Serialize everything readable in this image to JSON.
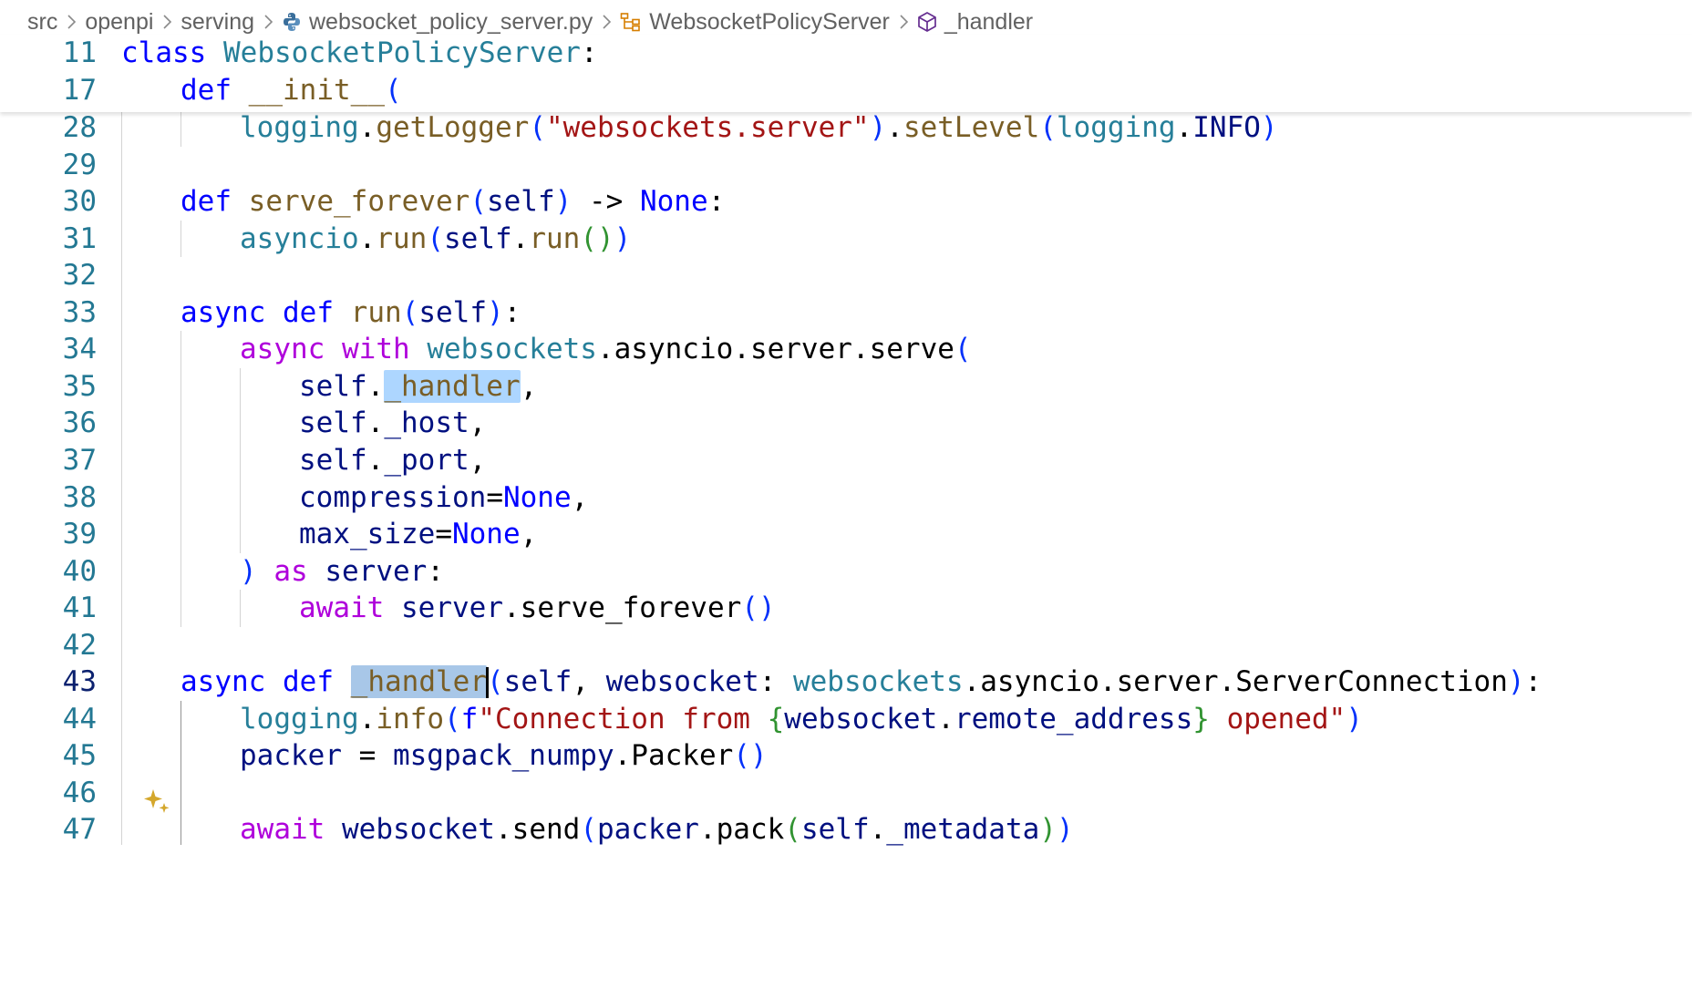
{
  "breadcrumb": {
    "items": [
      {
        "label": "src",
        "icon": ""
      },
      {
        "label": "openpi",
        "icon": ""
      },
      {
        "label": "serving",
        "icon": ""
      },
      {
        "label": "websocket_policy_server.py",
        "icon": "python-file-icon"
      },
      {
        "label": "WebsocketPolicyServer",
        "icon": "class-symbol-icon"
      },
      {
        "label": "_handler",
        "icon": "method-symbol-icon"
      }
    ]
  },
  "colors": {
    "keyword": "#0000ff",
    "control": "#af00db",
    "class": "#267f99",
    "function": "#795e26",
    "variable": "#001080",
    "string": "#a31515",
    "line_number": "#237893",
    "line_number_active": "#0b216f",
    "selection_highlight": "#add6ff",
    "sparkle": "#d4a72c"
  },
  "editor": {
    "active_line": "43",
    "sticky": [
      {
        "num": "11",
        "indent": 0,
        "tokens": [
          [
            "kw",
            "class"
          ],
          [
            "txt",
            " "
          ],
          [
            "cls",
            "WebsocketPolicyServer"
          ],
          [
            "txt",
            ":"
          ]
        ]
      },
      {
        "num": "17",
        "indent": 1,
        "tokens": [
          [
            "kw",
            "def"
          ],
          [
            "txt",
            " "
          ],
          [
            "fn",
            "__init__"
          ],
          [
            "p1",
            "("
          ]
        ]
      }
    ],
    "lines": [
      {
        "num": "28",
        "indent": 2,
        "tokens": [
          [
            "cls",
            "logging"
          ],
          [
            "txt",
            "."
          ],
          [
            "fn",
            "getLogger"
          ],
          [
            "p1",
            "("
          ],
          [
            "str",
            "\"websockets.server\""
          ],
          [
            "p1",
            ")"
          ],
          [
            "txt",
            "."
          ],
          [
            "fn",
            "setLevel"
          ],
          [
            "p1",
            "("
          ],
          [
            "cls",
            "logging"
          ],
          [
            "txt",
            "."
          ],
          [
            "var",
            "INFO"
          ],
          [
            "p1",
            ")"
          ]
        ]
      },
      {
        "num": "29",
        "indent": 0,
        "tokens": []
      },
      {
        "num": "30",
        "indent": 1,
        "tokens": [
          [
            "kw",
            "def"
          ],
          [
            "txt",
            " "
          ],
          [
            "fn",
            "serve_forever"
          ],
          [
            "p1",
            "("
          ],
          [
            "var",
            "self"
          ],
          [
            "p1",
            ")"
          ],
          [
            "txt",
            " -> "
          ],
          [
            "kw",
            "None"
          ],
          [
            "txt",
            ":"
          ]
        ]
      },
      {
        "num": "31",
        "indent": 2,
        "tokens": [
          [
            "cls",
            "asyncio"
          ],
          [
            "txt",
            "."
          ],
          [
            "fn",
            "run"
          ],
          [
            "p1",
            "("
          ],
          [
            "var",
            "self"
          ],
          [
            "txt",
            "."
          ],
          [
            "fn",
            "run"
          ],
          [
            "p2",
            "()"
          ],
          [
            "p1",
            ")"
          ]
        ]
      },
      {
        "num": "32",
        "indent": 0,
        "tokens": []
      },
      {
        "num": "33",
        "indent": 1,
        "tokens": [
          [
            "kw",
            "async"
          ],
          [
            "txt",
            " "
          ],
          [
            "kw",
            "def"
          ],
          [
            "txt",
            " "
          ],
          [
            "fn",
            "run"
          ],
          [
            "p1",
            "("
          ],
          [
            "var",
            "self"
          ],
          [
            "p1",
            ")"
          ],
          [
            "txt",
            ":"
          ]
        ]
      },
      {
        "num": "34",
        "indent": 2,
        "tokens": [
          [
            "ctl",
            "async"
          ],
          [
            "txt",
            " "
          ],
          [
            "ctl",
            "with"
          ],
          [
            "txt",
            " "
          ],
          [
            "cls",
            "websockets"
          ],
          [
            "txt",
            ".asyncio.server.serve"
          ],
          [
            "p1",
            "("
          ]
        ]
      },
      {
        "num": "35",
        "indent": 3,
        "tokens": [
          [
            "var",
            "self"
          ],
          [
            "txt",
            "."
          ],
          [
            "fnhl",
            "_handler"
          ],
          [
            "txt",
            ","
          ]
        ]
      },
      {
        "num": "36",
        "indent": 3,
        "tokens": [
          [
            "var",
            "self"
          ],
          [
            "txt",
            "."
          ],
          [
            "var",
            "_host"
          ],
          [
            "txt",
            ","
          ]
        ]
      },
      {
        "num": "37",
        "indent": 3,
        "tokens": [
          [
            "var",
            "self"
          ],
          [
            "txt",
            "."
          ],
          [
            "var",
            "_port"
          ],
          [
            "txt",
            ","
          ]
        ]
      },
      {
        "num": "38",
        "indent": 3,
        "tokens": [
          [
            "var",
            "compression"
          ],
          [
            "txt",
            "="
          ],
          [
            "kw",
            "None"
          ],
          [
            "txt",
            ","
          ]
        ]
      },
      {
        "num": "39",
        "indent": 3,
        "tokens": [
          [
            "var",
            "max_size"
          ],
          [
            "txt",
            "="
          ],
          [
            "kw",
            "None"
          ],
          [
            "txt",
            ","
          ]
        ]
      },
      {
        "num": "40",
        "indent": 2,
        "tokens": [
          [
            "p1",
            ")"
          ],
          [
            "txt",
            " "
          ],
          [
            "ctl",
            "as"
          ],
          [
            "txt",
            " "
          ],
          [
            "var",
            "server"
          ],
          [
            "txt",
            ":"
          ]
        ]
      },
      {
        "num": "41",
        "indent": 3,
        "tokens": [
          [
            "ctl",
            "await"
          ],
          [
            "txt",
            " "
          ],
          [
            "var",
            "server"
          ],
          [
            "txt",
            "."
          ],
          [
            "txt",
            "serve_forever"
          ],
          [
            "p1",
            "()"
          ]
        ]
      },
      {
        "num": "42",
        "indent": 0,
        "tokens": []
      },
      {
        "num": "43",
        "indent": 1,
        "tokens": [
          [
            "kw",
            "async"
          ],
          [
            "txt",
            " "
          ],
          [
            "kw",
            "def"
          ],
          [
            "txt",
            " "
          ],
          [
            "fnhl2",
            "_handler"
          ],
          [
            "p1",
            "("
          ],
          [
            "var",
            "self"
          ],
          [
            "txt",
            ", "
          ],
          [
            "var",
            "websocket"
          ],
          [
            "txt",
            ": "
          ],
          [
            "cls",
            "websockets"
          ],
          [
            "txt",
            "."
          ],
          [
            "txt",
            "asyncio"
          ],
          [
            "txt",
            "."
          ],
          [
            "txt",
            "server"
          ],
          [
            "txt",
            "."
          ],
          [
            "txt",
            "ServerConnection"
          ],
          [
            "p1",
            ")"
          ],
          [
            "txt",
            ":"
          ]
        ]
      },
      {
        "num": "44",
        "indent": 2,
        "tokens": [
          [
            "cls",
            "logging"
          ],
          [
            "txt",
            "."
          ],
          [
            "fn",
            "info"
          ],
          [
            "p1",
            "("
          ],
          [
            "kw",
            "f"
          ],
          [
            "str",
            "\"Connection from "
          ],
          [
            "p2",
            "{"
          ],
          [
            "var",
            "websocket"
          ],
          [
            "txt",
            "."
          ],
          [
            "var",
            "remote_address"
          ],
          [
            "p2",
            "}"
          ],
          [
            "str",
            " opened\""
          ],
          [
            "p1",
            ")"
          ]
        ]
      },
      {
        "num": "45",
        "indent": 2,
        "tokens": [
          [
            "var",
            "packer"
          ],
          [
            "txt",
            " = "
          ],
          [
            "var",
            "msgpack_numpy"
          ],
          [
            "txt",
            "."
          ],
          [
            "txt",
            "Packer"
          ],
          [
            "p1",
            "()"
          ]
        ]
      },
      {
        "num": "46",
        "indent": 0,
        "tokens": []
      },
      {
        "num": "47",
        "indent": 2,
        "tokens": [
          [
            "ctl",
            "await"
          ],
          [
            "txt",
            " "
          ],
          [
            "var",
            "websocket"
          ],
          [
            "txt",
            "."
          ],
          [
            "txt",
            "send"
          ],
          [
            "p1",
            "("
          ],
          [
            "var",
            "packer"
          ],
          [
            "txt",
            "."
          ],
          [
            "txt",
            "pack"
          ],
          [
            "p2",
            "("
          ],
          [
            "var",
            "self"
          ],
          [
            "txt",
            "."
          ],
          [
            "var",
            "_metadata"
          ],
          [
            "p2",
            ")"
          ],
          [
            "p1",
            ")"
          ]
        ]
      }
    ]
  }
}
